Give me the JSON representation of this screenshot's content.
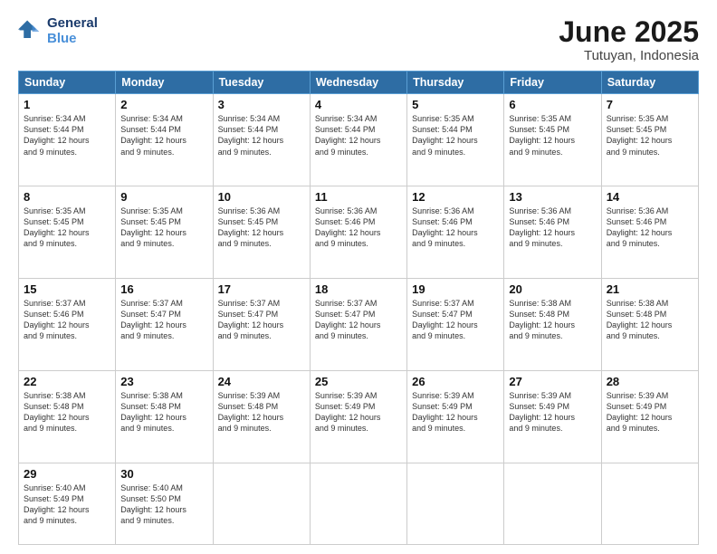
{
  "logo": {
    "line1": "General",
    "line2": "Blue"
  },
  "title": "June 2025",
  "subtitle": "Tutuyan, Indonesia",
  "headers": [
    "Sunday",
    "Monday",
    "Tuesday",
    "Wednesday",
    "Thursday",
    "Friday",
    "Saturday"
  ],
  "weeks": [
    [
      {
        "day": "1",
        "info": "Sunrise: 5:34 AM\nSunset: 5:44 PM\nDaylight: 12 hours\nand 9 minutes."
      },
      {
        "day": "2",
        "info": "Sunrise: 5:34 AM\nSunset: 5:44 PM\nDaylight: 12 hours\nand 9 minutes."
      },
      {
        "day": "3",
        "info": "Sunrise: 5:34 AM\nSunset: 5:44 PM\nDaylight: 12 hours\nand 9 minutes."
      },
      {
        "day": "4",
        "info": "Sunrise: 5:34 AM\nSunset: 5:44 PM\nDaylight: 12 hours\nand 9 minutes."
      },
      {
        "day": "5",
        "info": "Sunrise: 5:35 AM\nSunset: 5:44 PM\nDaylight: 12 hours\nand 9 minutes."
      },
      {
        "day": "6",
        "info": "Sunrise: 5:35 AM\nSunset: 5:45 PM\nDaylight: 12 hours\nand 9 minutes."
      },
      {
        "day": "7",
        "info": "Sunrise: 5:35 AM\nSunset: 5:45 PM\nDaylight: 12 hours\nand 9 minutes."
      }
    ],
    [
      {
        "day": "8",
        "info": "Sunrise: 5:35 AM\nSunset: 5:45 PM\nDaylight: 12 hours\nand 9 minutes."
      },
      {
        "day": "9",
        "info": "Sunrise: 5:35 AM\nSunset: 5:45 PM\nDaylight: 12 hours\nand 9 minutes."
      },
      {
        "day": "10",
        "info": "Sunrise: 5:36 AM\nSunset: 5:45 PM\nDaylight: 12 hours\nand 9 minutes."
      },
      {
        "day": "11",
        "info": "Sunrise: 5:36 AM\nSunset: 5:46 PM\nDaylight: 12 hours\nand 9 minutes."
      },
      {
        "day": "12",
        "info": "Sunrise: 5:36 AM\nSunset: 5:46 PM\nDaylight: 12 hours\nand 9 minutes."
      },
      {
        "day": "13",
        "info": "Sunrise: 5:36 AM\nSunset: 5:46 PM\nDaylight: 12 hours\nand 9 minutes."
      },
      {
        "day": "14",
        "info": "Sunrise: 5:36 AM\nSunset: 5:46 PM\nDaylight: 12 hours\nand 9 minutes."
      }
    ],
    [
      {
        "day": "15",
        "info": "Sunrise: 5:37 AM\nSunset: 5:46 PM\nDaylight: 12 hours\nand 9 minutes."
      },
      {
        "day": "16",
        "info": "Sunrise: 5:37 AM\nSunset: 5:47 PM\nDaylight: 12 hours\nand 9 minutes."
      },
      {
        "day": "17",
        "info": "Sunrise: 5:37 AM\nSunset: 5:47 PM\nDaylight: 12 hours\nand 9 minutes."
      },
      {
        "day": "18",
        "info": "Sunrise: 5:37 AM\nSunset: 5:47 PM\nDaylight: 12 hours\nand 9 minutes."
      },
      {
        "day": "19",
        "info": "Sunrise: 5:37 AM\nSunset: 5:47 PM\nDaylight: 12 hours\nand 9 minutes."
      },
      {
        "day": "20",
        "info": "Sunrise: 5:38 AM\nSunset: 5:48 PM\nDaylight: 12 hours\nand 9 minutes."
      },
      {
        "day": "21",
        "info": "Sunrise: 5:38 AM\nSunset: 5:48 PM\nDaylight: 12 hours\nand 9 minutes."
      }
    ],
    [
      {
        "day": "22",
        "info": "Sunrise: 5:38 AM\nSunset: 5:48 PM\nDaylight: 12 hours\nand 9 minutes."
      },
      {
        "day": "23",
        "info": "Sunrise: 5:38 AM\nSunset: 5:48 PM\nDaylight: 12 hours\nand 9 minutes."
      },
      {
        "day": "24",
        "info": "Sunrise: 5:39 AM\nSunset: 5:48 PM\nDaylight: 12 hours\nand 9 minutes."
      },
      {
        "day": "25",
        "info": "Sunrise: 5:39 AM\nSunset: 5:49 PM\nDaylight: 12 hours\nand 9 minutes."
      },
      {
        "day": "26",
        "info": "Sunrise: 5:39 AM\nSunset: 5:49 PM\nDaylight: 12 hours\nand 9 minutes."
      },
      {
        "day": "27",
        "info": "Sunrise: 5:39 AM\nSunset: 5:49 PM\nDaylight: 12 hours\nand 9 minutes."
      },
      {
        "day": "28",
        "info": "Sunrise: 5:39 AM\nSunset: 5:49 PM\nDaylight: 12 hours\nand 9 minutes."
      }
    ],
    [
      {
        "day": "29",
        "info": "Sunrise: 5:40 AM\nSunset: 5:49 PM\nDaylight: 12 hours\nand 9 minutes."
      },
      {
        "day": "30",
        "info": "Sunrise: 5:40 AM\nSunset: 5:50 PM\nDaylight: 12 hours\nand 9 minutes."
      },
      {
        "day": "",
        "info": ""
      },
      {
        "day": "",
        "info": ""
      },
      {
        "day": "",
        "info": ""
      },
      {
        "day": "",
        "info": ""
      },
      {
        "day": "",
        "info": ""
      }
    ]
  ]
}
